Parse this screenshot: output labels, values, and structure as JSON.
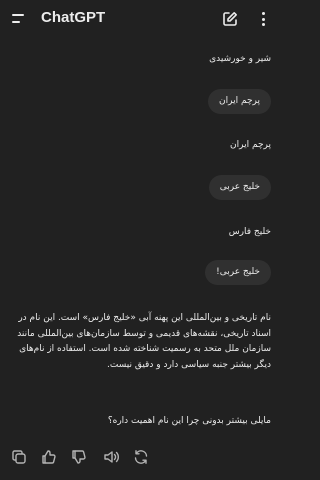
{
  "header": {
    "title": "ChatGPT",
    "menu_icon": "menu-icon",
    "new_chat_icon": "edit-icon",
    "more_icon": "more-vertical-icon"
  },
  "conversation": [
    {
      "role": "assistant",
      "text": "شیر و خورشیدی"
    },
    {
      "role": "user",
      "text": "پرچم ایران"
    },
    {
      "role": "assistant",
      "text": "پرچم ایران"
    },
    {
      "role": "user",
      "text": "خلیج عربی"
    },
    {
      "role": "assistant",
      "text": "خلیج فارس"
    },
    {
      "role": "user",
      "text": "خلیج عربی!"
    }
  ],
  "final_answer": {
    "paragraph1": "نام تاریخی و بین‌المللی این پهنه آبی «خلیج فارس» است. این نام در اسناد تاریخی، نقشه‌های قدیمی و توسط سازمان‌های بین‌المللی مانند سازمان ملل متحد به رسمیت شناخته شده است. استفاده از نام‌های دیگر بیشتر جنبه سیاسی دارد و دقیق نیست.",
    "followup": "مایلی بیشتر بدونی چرا این نام اهمیت داره؟"
  },
  "action_icons": [
    "copy-icon",
    "thumbs-up-icon",
    "thumbs-down-icon",
    "speaker-icon",
    "regenerate-icon"
  ]
}
